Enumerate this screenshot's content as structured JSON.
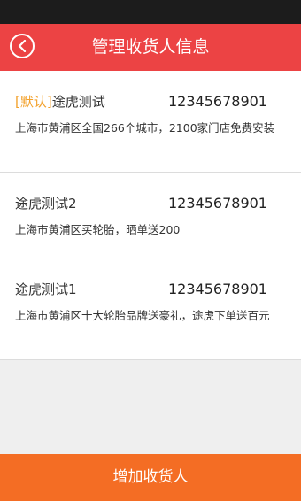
{
  "header": {
    "title": "管理收货人信息",
    "back_icon": "chevron-left-circle-icon"
  },
  "addresses": [
    {
      "default_tag": "[默认]",
      "name": "途虎测试",
      "phone": "12345678901",
      "address": "上海市黄浦区全国266个城市，2100家门店免费安装"
    },
    {
      "default_tag": "",
      "name": "途虎测试2",
      "phone": "12345678901",
      "address": "上海市黄浦区买轮胎，晒单送200"
    },
    {
      "default_tag": "",
      "name": "途虎测试1",
      "phone": "12345678901",
      "address": "上海市黄浦区十大轮胎品牌送豪礼，途虎下单送百元"
    }
  ],
  "footer": {
    "add_label": "增加收货人"
  },
  "colors": {
    "header_bg": "#ec4344",
    "default_tag": "#f3a12b",
    "add_button_bg": "#f46d24"
  }
}
